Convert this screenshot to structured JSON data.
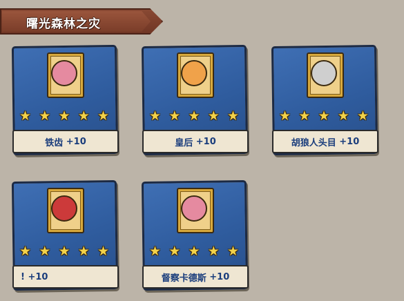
{
  "header": {
    "title": "曙光森林之灾"
  },
  "cards": [
    {
      "name": "铁齿",
      "bonus": "+10",
      "stars": 5,
      "portrait_color": "#e58aa0"
    },
    {
      "name": "皇后",
      "bonus": "+10",
      "stars": 5,
      "portrait_color": "#f0a24a"
    },
    {
      "name": "胡狼人头目",
      "bonus": "+10",
      "stars": 5,
      "portrait_color": "#cfcfcf"
    },
    {
      "name": "!",
      "bonus": "+10",
      "stars": 5,
      "portrait_color": "#cc3a3a"
    },
    {
      "name": "督察卡德斯",
      "bonus": "+10",
      "stars": 5,
      "portrait_color": "#e58aa0"
    }
  ],
  "colors": {
    "card_blue": "#3f6fb4",
    "star_gold": "#f3d24a",
    "label_text": "#1a3d7c",
    "banner": "#8a4a34"
  }
}
